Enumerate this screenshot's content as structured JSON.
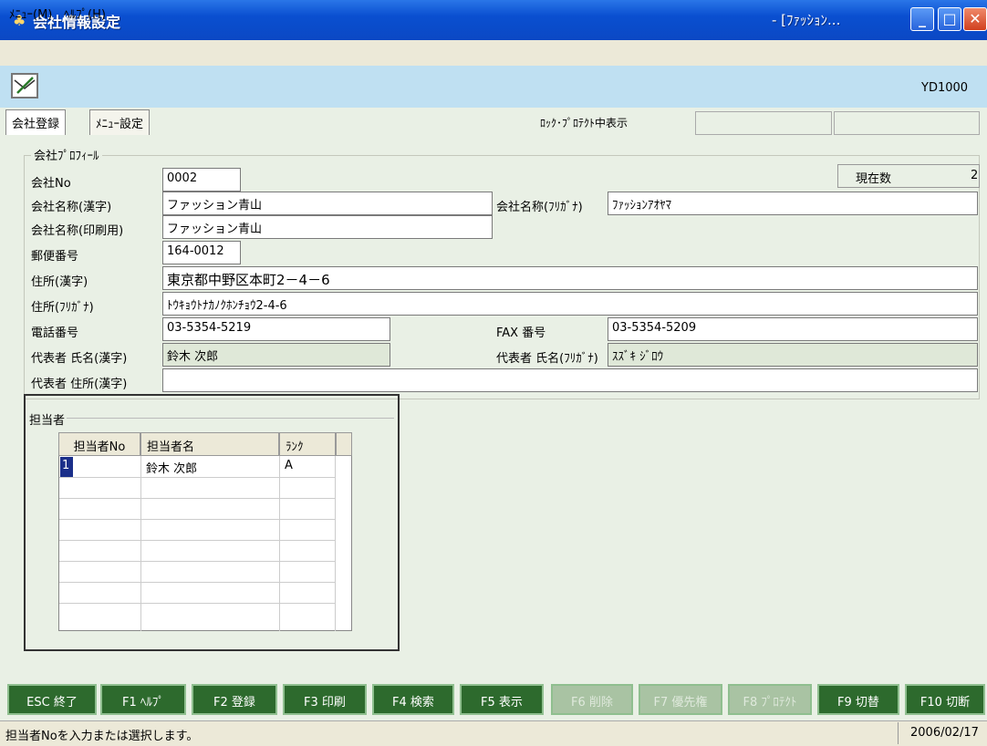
{
  "window": {
    "title": "会社情報設定",
    "doc_title": "- [ﾌｧｯｼｮﾝ...",
    "app_icon": "app-icon"
  },
  "menubar": {
    "items": [
      "ﾒﾆｭｰ(M)",
      "ﾍﾙﾌﾟ(H)"
    ]
  },
  "toolbar": {
    "mail_icon": "mail-icon",
    "screen_id": "YD1000"
  },
  "tabs": [
    {
      "label": "会社登録",
      "active": true
    },
    {
      "label": "ﾒﾆｭｰ設定",
      "active": false
    }
  ],
  "lock_protect": {
    "label": "ﾛｯｸ･ﾌﾟﾛﾃｸﾄ中表示"
  },
  "profile": {
    "legend": "会社ﾌﾟﾛﾌｨｰﾙ",
    "current_count_label": "現在数",
    "current_count_value": "2",
    "fields": {
      "company_no": {
        "label": "会社No",
        "value": "0002"
      },
      "name_kanji": {
        "label": "会社名称(漢字)",
        "value": "ファッション青山"
      },
      "name_kana": {
        "label": "会社名称(ﾌﾘｶﾞﾅ)",
        "value": "ﾌｧｯｼｮﾝｱｵﾔﾏ"
      },
      "name_print": {
        "label": "会社名称(印刷用)",
        "value": "ファッション青山"
      },
      "postal": {
        "label": "郵便番号",
        "value": "164-0012"
      },
      "addr_kanji": {
        "label": "住所(漢字)",
        "value": "東京都中野区本町2－4－6"
      },
      "addr_kana": {
        "label": "住所(ﾌﾘｶﾞﾅ)",
        "value": "ﾄｳｷｮｳﾄﾅｶﾉｸﾎﾝﾁｮｳ2-4-6"
      },
      "phone": {
        "label": "電話番号",
        "value": "03-5354-5219"
      },
      "fax": {
        "label": "FAX 番号",
        "value": "03-5354-5209"
      },
      "rep_kanji": {
        "label": "代表者 氏名(漢字)",
        "value": "鈴木 次郎"
      },
      "rep_kana": {
        "label": "代表者 氏名(ﾌﾘｶﾞﾅ)",
        "value": "ｽｽﾞｷ ｼﾞﾛｳ"
      },
      "rep_addr": {
        "label": "代表者 住所(漢字)",
        "value": ""
      }
    }
  },
  "staff": {
    "legend": "担当者",
    "columns": [
      "担当者No",
      "担当者名",
      "ﾗﾝｸ"
    ],
    "rows": [
      {
        "no": "1",
        "name": "鈴木 次郎",
        "rank": "A"
      }
    ]
  },
  "fkeys": [
    {
      "label": "ESC 終了",
      "enabled": true
    },
    {
      "label": "F1 ﾍﾙﾌﾟ",
      "enabled": true
    },
    {
      "label": "F2 登録",
      "enabled": true
    },
    {
      "label": "F3 印刷",
      "enabled": true
    },
    {
      "label": "F4 検索",
      "enabled": true
    },
    {
      "label": "F5 表示",
      "enabled": true
    },
    {
      "label": "F6 削除",
      "enabled": false
    },
    {
      "label": "F7 優先権",
      "enabled": false
    },
    {
      "label": "F8 ﾌﾟﾛﾃｸﾄ",
      "enabled": false
    },
    {
      "label": "F9 切替",
      "enabled": true
    },
    {
      "label": "F10 切断",
      "enabled": true
    }
  ],
  "statusbar": {
    "message": "担当者Noを入力または選択します。",
    "date": "2006/02/17"
  }
}
